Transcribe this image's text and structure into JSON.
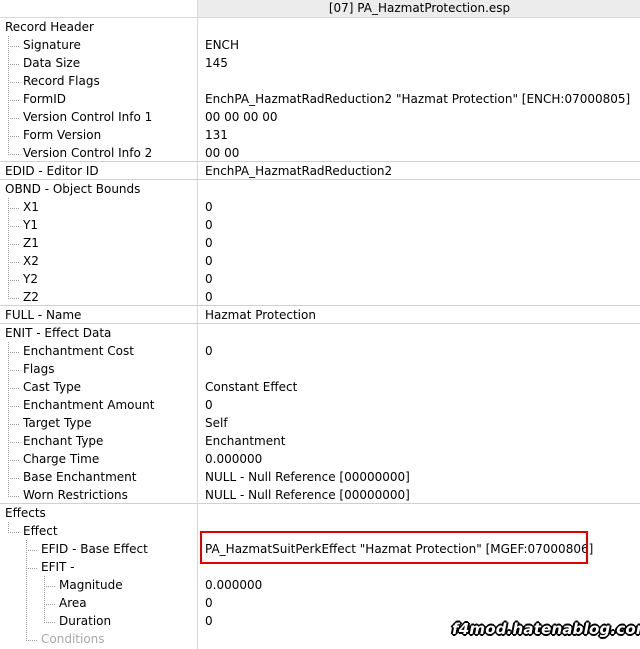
{
  "header": {
    "title": "[07] PA_HazmatProtection.esp"
  },
  "rows": [
    {
      "name": "Record Header",
      "value": ""
    },
    {
      "name": "Signature",
      "value": "ENCH"
    },
    {
      "name": "Data Size",
      "value": "145"
    },
    {
      "name": "Record Flags",
      "value": ""
    },
    {
      "name": "FormID",
      "value": "EnchPA_HazmatRadReduction2 \"Hazmat Protection\" [ENCH:07000805]"
    },
    {
      "name": "Version Control Info 1",
      "value": "00 00 00 00"
    },
    {
      "name": "Form Version",
      "value": "131"
    },
    {
      "name": "Version Control Info 2",
      "value": "00 00"
    },
    {
      "name": "EDID - Editor ID",
      "value": "EnchPA_HazmatRadReduction2"
    },
    {
      "name": "OBND - Object Bounds",
      "value": ""
    },
    {
      "name": "X1",
      "value": "0"
    },
    {
      "name": "Y1",
      "value": "0"
    },
    {
      "name": "Z1",
      "value": "0"
    },
    {
      "name": "X2",
      "value": "0"
    },
    {
      "name": "Y2",
      "value": "0"
    },
    {
      "name": "Z2",
      "value": "0"
    },
    {
      "name": "FULL - Name",
      "value": "Hazmat Protection"
    },
    {
      "name": "ENIT - Effect Data",
      "value": ""
    },
    {
      "name": "Enchantment Cost",
      "value": "0"
    },
    {
      "name": "Flags",
      "value": ""
    },
    {
      "name": "Cast Type",
      "value": "Constant Effect"
    },
    {
      "name": "Enchantment Amount",
      "value": "0"
    },
    {
      "name": "Target Type",
      "value": "Self"
    },
    {
      "name": "Enchant Type",
      "value": "Enchantment"
    },
    {
      "name": "Charge Time",
      "value": "0.000000"
    },
    {
      "name": "Base Enchantment",
      "value": "NULL - Null Reference [00000000]"
    },
    {
      "name": "Worn Restrictions",
      "value": "NULL - Null Reference [00000000]"
    },
    {
      "name": "Effects",
      "value": ""
    },
    {
      "name": "Effect",
      "value": ""
    },
    {
      "name": "EFID - Base Effect",
      "value": "PA_HazmatSuitPerkEffect \"Hazmat Protection\" [MGEF:07000806]"
    },
    {
      "name": "EFIT -",
      "value": ""
    },
    {
      "name": "Magnitude",
      "value": "0.000000"
    },
    {
      "name": "Area",
      "value": "0"
    },
    {
      "name": "Duration",
      "value": "0"
    },
    {
      "name": "Conditions",
      "value": ""
    }
  ],
  "watermark": "f4mod.hatenablog.com"
}
